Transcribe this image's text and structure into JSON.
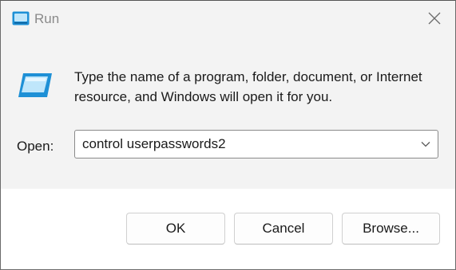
{
  "window": {
    "title": "Run",
    "icon": "run-icon",
    "close_icon": "close-icon"
  },
  "main": {
    "description": "Type the name of a program, folder, document, or Internet resource, and Windows will open it for you.",
    "open_label": "Open:",
    "open_value": "control userpasswords2",
    "dropdown_icon": "chevron-down-icon"
  },
  "buttons": {
    "ok": "OK",
    "cancel": "Cancel",
    "browse": "Browse..."
  },
  "colors": {
    "accent": "#1e90d6",
    "panel_bg": "#f3f3f3",
    "text": "#1a1a1a"
  }
}
